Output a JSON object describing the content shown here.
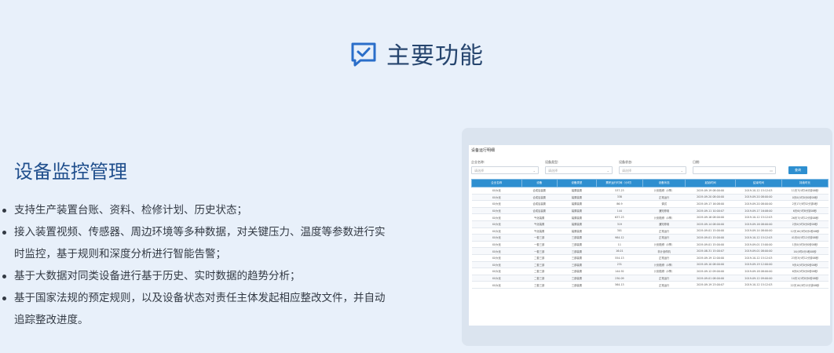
{
  "header": {
    "title": "主要功能"
  },
  "feature": {
    "title": "设备监控管理",
    "bullets": [
      "支持生产装置台账、资料、检修计划、历史状态；",
      "接入装置视频、传感器、周边环境等多种数据，对关键压力、温度等参数进行实时监控，基于规则和深度分析进行智能告警；",
      "基于大数据对同类设备进行基于历史、实时数据的趋势分析；",
      "基于国家法规的预定规则，以及设备状态对责任主体发起相应整改文件，并自动追踪整改进度。"
    ]
  },
  "screenshot": {
    "title": "设备运行明细",
    "filters": [
      {
        "label": "企业名称:",
        "placeholder": "请选择"
      },
      {
        "label": "设备类型:",
        "placeholder": "请选择"
      },
      {
        "label": "设备状态:",
        "placeholder": "请选择"
      },
      {
        "label": "日期:",
        "placeholder": ""
      }
    ],
    "query_label": "查询",
    "columns": [
      "企业名称",
      "设备",
      "设备类型",
      "累积运行时间（小时）",
      "设备状态",
      "起始时间",
      "结束时间",
      "持续时长"
    ],
    "rows": [
      [
        "XX大化",
        "合成氨装置",
        "装置装置",
        "537.23",
        "计划检修（4季）",
        "2019-09-19 08:00:00",
        "2019-10-12 15:12:03",
        "11天7小时16分钟08秒"
      ],
      [
        "XX大化",
        "合成氨装置",
        "装置装置",
        "338",
        "正常运行",
        "2019-09-20 08:00:00",
        "2019-09-20 08:00:00",
        "0天0小时0分0秒08秒"
      ],
      [
        "XX大化",
        "合成氨装置",
        "装置装置",
        "86.9",
        "调试",
        "2019-09-17 16:08:00",
        "2019-09-20 08:00:00",
        "2天17小时52分钟0秒"
      ],
      [
        "XX大化",
        "合成氨装置",
        "装置装置",
        "144",
        "通知停用",
        "2019-09-11 10:00:07",
        "2019-09-17 16:08:00",
        "6天6小时8分钟08秒"
      ],
      [
        "XX大化",
        "气化装置",
        "装置装置",
        "637.23",
        "计划检修（4季）",
        "2019-09-16 08:00:00",
        "2019-10-12 15:12:03",
        "26天7小时12分钟08秒"
      ],
      [
        "XX大化",
        "气化装置",
        "装置装置",
        "319",
        "通知停用",
        "2019-09-14 08:00:00",
        "2019-09-16 08:00:00",
        "2天0小时0分0秒08秒"
      ],
      [
        "XX大化",
        "气化装置",
        "装置装置",
        "301",
        "正常运行",
        "2019-09-01 15:00:00",
        "2019-09-14 08:00:00",
        "12天16小时0分0秒08秒"
      ],
      [
        "XX大化",
        "一套三部",
        "三部装置",
        "984.12",
        "正常运行",
        "2019-09-01 15:00:00",
        "2019-10-12 15:12:03",
        "41天0小时12分钟08秒"
      ],
      [
        "XX大化",
        "一套三部",
        "三部装置",
        "11",
        "计划检修（4季）",
        "2019-09-01 15:00:00",
        "2019-09-01 15:00:00",
        "1天0小时0分0秒08秒"
      ],
      [
        "XX大化",
        "一套三部",
        "三部装置",
        "16.01",
        "非计划停机",
        "2019-08-31 15:00:07",
        "2019-09-01 08:00:00",
        "16小时0分0秒08秒"
      ],
      [
        "XX大化",
        "二套三部",
        "三部装置",
        "554.13",
        "正常运行",
        "2019-09-19 12:00:00",
        "2019-10-12 15:12:03",
        "23天3小时12分钟08秒"
      ],
      [
        "XX大化",
        "二套三部",
        "三部装置",
        "231",
        "计划检修（4季）",
        "2019-09-10 08:00:00",
        "2019-09-19 12:00:00",
        "9天4小时0分0秒08秒"
      ],
      [
        "XX大化",
        "二套三部",
        "三部装置",
        "144.92",
        "计划检修（4季）",
        "2019-09-12 09:00:00",
        "2019-09-18 08:00:00",
        "6天0小时0分0秒08秒"
      ],
      [
        "XX大化",
        "二套三部",
        "三部装置",
        "230.09",
        "正常运行",
        "2019-09-01 08:00:00",
        "2019-09-12 09:00:00",
        "10天1小时0分0秒08秒"
      ],
      [
        "XX大化",
        "三套三部",
        "三部装置",
        "564.13",
        "正常运行",
        "2019-09-19 23:00:07",
        "2019-10-12 15:12:03",
        "22天16小时12分钟08秒"
      ]
    ]
  }
}
